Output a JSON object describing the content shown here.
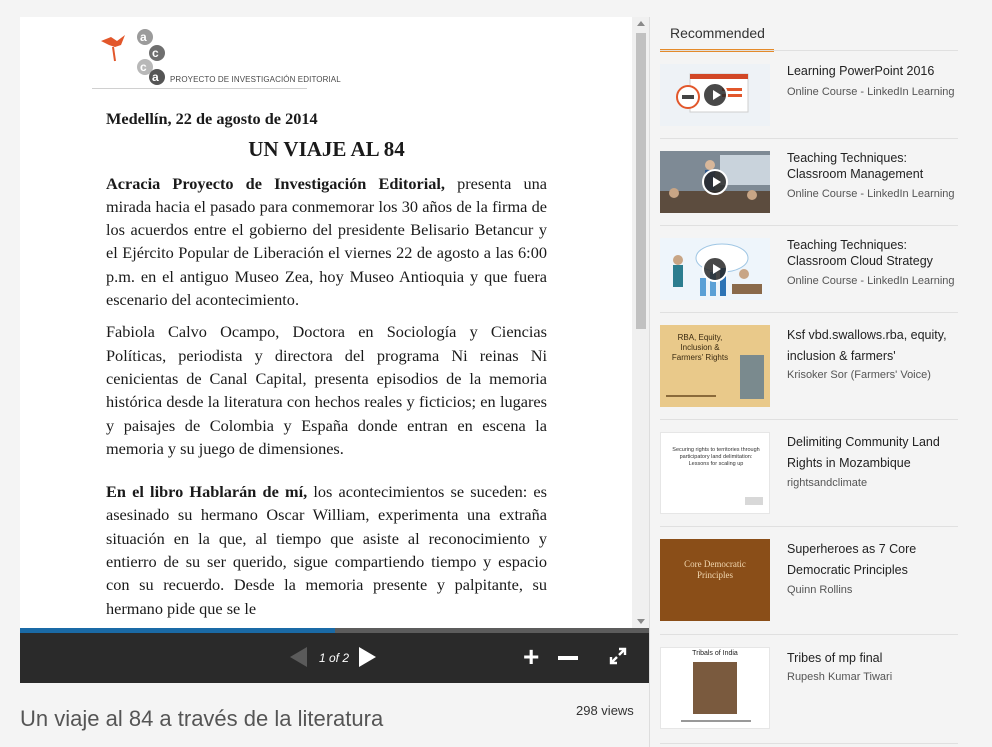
{
  "document": {
    "logo_caption": "PROYECTO DE INVESTIGACIÓN EDITORIAL",
    "date": "Medellín, 22 de agosto de 2014",
    "heading": "UN VIAJE AL 84",
    "p1_bold": "Acracia Proyecto de Investigación Editorial,",
    "p1_rest": " presenta una mirada hacia el pasado para conmemorar los 30 años de la firma de los acuerdos entre el gobierno del presidente Belisario Betancur y el Ejército Popular de Liberación el viernes 22 de agosto a las 6:00 p.m. en el antiguo Museo Zea, hoy Museo Antioquia y que fuera escenario del acontecimiento.",
    "p2": "Fabiola Calvo Ocampo, Doctora en Sociología y Ciencias Políticas, periodista y directora del programa Ni reinas Ni cenicientas de Canal Capital, presenta episodios de la memoria histórica desde la literatura con hechos reales y ficticios; en lugares y paisajes de Colombia y España donde entran en escena la memoria y su juego de dimensiones.",
    "p3_bold": "En el libro Hablarán de mí,",
    "p3_rest": " los acontecimientos se suceden: es asesinado su hermano Oscar William, experimenta una extraña situación en la que, al tiempo que asiste al reconocimiento y entierro de su ser querido, sigue compartiendo tiempo y espacio con su recuerdo. Desde la memoria presente y palpitante, su hermano pide que se le"
  },
  "viewer": {
    "page_indicator": "1 of 2",
    "progress": 0.5,
    "zoom_in_icon": "plus-icon",
    "zoom_out_icon": "minus-icon",
    "fullscreen_icon": "expand-icon"
  },
  "presentation": {
    "title": "Un viaje al 84 a través de la literatura",
    "views": "298 views"
  },
  "sidebar": {
    "tab_label": "Recommended",
    "accent": "#e48a2a",
    "items": [
      {
        "title": "Learning PowerPoint 2016",
        "subtitle": "Online Course - LinkedIn Learning"
      },
      {
        "title": "Teaching Techniques: Classroom Management",
        "subtitle": "Online Course - LinkedIn Learning"
      },
      {
        "title": "Teaching Techniques: Classroom Cloud Strategy",
        "subtitle": "Online Course - LinkedIn Learning"
      },
      {
        "title": "Ksf vbd.swallows.rba, equity, inclusion & farmers'",
        "subtitle": "Krisoker Sor (Farmers' Voice)",
        "thumb_text": "RBA, Equity, Inclusion & Farmers' Rights"
      },
      {
        "title": "Delimiting Community Land Rights in Mozambique",
        "subtitle": "rightsandclimate",
        "thumb_text": "Securing rights to territories through participatory land delimitation: Lessons for scaling up"
      },
      {
        "title": "Superheroes as 7 Core Democratic Principles",
        "subtitle": "Quinn Rollins",
        "thumb_text": "Core Democratic Principles"
      },
      {
        "title": "Tribes of mp final",
        "subtitle": "Rupesh Kumar Tiwari",
        "thumb_text": "Tribals of India"
      }
    ]
  }
}
